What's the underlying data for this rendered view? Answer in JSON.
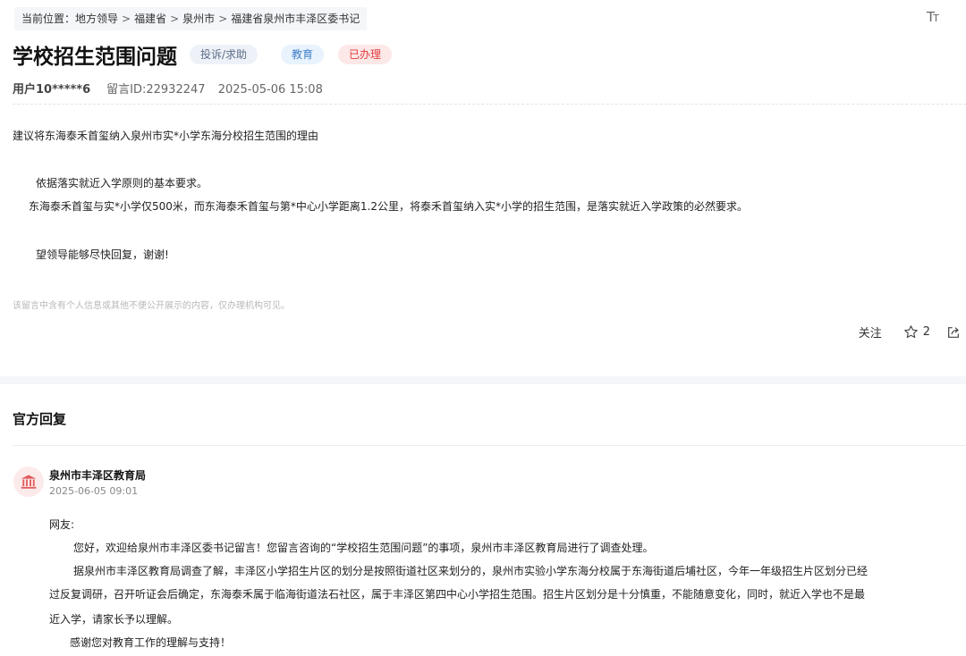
{
  "breadcrumb": {
    "prefix": "当前位置：",
    "items": [
      "地方领导",
      "福建省",
      "泉州市",
      "福建省泉州市丰泽区委书记"
    ]
  },
  "font_size_toggle": "TT",
  "message": {
    "title": "学校招生范围问题",
    "tags": {
      "type": "投诉/求助",
      "field": "教育",
      "status": "已办理"
    },
    "user": "用户10*****6",
    "message_id": "留言ID:22932247",
    "datetime": "2025-05-06 15:08",
    "paragraphs": [
      "建议将东海泰禾首玺纳入泉州市实*小学东海分校招生范围的理由",
      "依据落实就近入学原则的基本要求。",
      "东海泰禾首玺与实*小学仅500米，而东海泰禾首玺与第*中心小学距离1.2公里，将泰禾首玺纳入实*小学的招生范围，是落实就近入学政策的必然要求。",
      "望领导能够尽快回复，谢谢!"
    ],
    "privacy_note": "该留言中含有个人信息或其他不便公开展示的内容，仅办理机构可见。"
  },
  "actions": {
    "follow": "关注",
    "star_count": "2"
  },
  "reply": {
    "heading": "官方回复",
    "org": "泉州市丰泽区教育局",
    "datetime": "2025-06-05 09:01",
    "lines": [
      "网友:",
      "您好，欢迎给泉州市丰泽区委书记留言！您留言咨询的“学校招生范围问题”的事项，泉州市丰泽区教育局进行了调查处理。",
      "据泉州市丰泽区教育局调查了解，丰泽区小学招生片区的划分是按照街道社区来划分的，泉州市实验小学东海分校属于东海街道后埔社区，今年一年级招生片区划分已经",
      "过反复调研，召开听证会后确定，东海泰禾属于临海街道法石社区，属于丰泽区第四中心小学招生范围。招生片区划分是十分慎重，不能随意变化，同时，就近入学也不是最",
      "近入学，请家长予以理解。",
      "感谢您对教育工作的理解与支持！"
    ]
  },
  "colors": {
    "status_red": "#e23b3b",
    "field_blue": "#3f7ec9",
    "avatar_bg": "#fdeaea"
  },
  "icons": [
    "star-icon",
    "share-icon",
    "government-building-icon"
  ]
}
